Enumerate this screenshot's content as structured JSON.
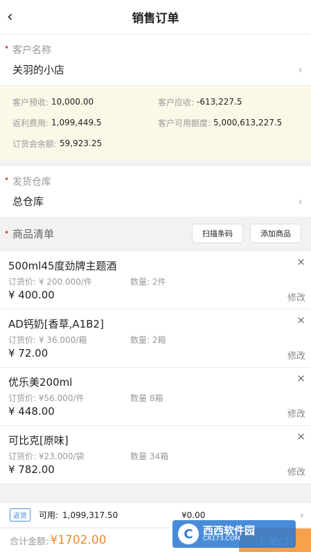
{
  "header": {
    "title": "销售订单",
    "back_icon": "chevron-left-icon"
  },
  "customer": {
    "label": "客户名称",
    "value": "关羽的小店",
    "required_mark": "•"
  },
  "credit": {
    "prepaid_label": "客户预收:",
    "prepaid_value": "10,000.00",
    "receivable_label": "客户应收:",
    "receivable_value": "-613,227.5",
    "rebate_label": "返利费用:",
    "rebate_value": "1,099,449.5",
    "available_label": "客户可用额度:",
    "available_value": "5,000,613,227.5",
    "balance_label": "订货会余额:",
    "balance_value": "59,923.25"
  },
  "warehouse": {
    "label": "发货仓库",
    "value": "总仓库",
    "required_mark": "•"
  },
  "goods": {
    "label": "商品清单",
    "required_mark": "•",
    "scan_button": "扫描条码",
    "add_button": "添加商品",
    "items": [
      {
        "name": "500ml45度劲牌主题酒",
        "price": "订货价: ¥ 200.000/件",
        "qty": "数量: 2件",
        "total": "¥ 400.00",
        "edit": "修改",
        "close": "×"
      },
      {
        "name": "AD钙奶[香草,A1B2]",
        "price": "订货价: ¥ 36.000/箱",
        "qty": "数量: 2箱",
        "total": "¥ 72.00",
        "edit": "修改",
        "close": "×"
      },
      {
        "name": "优乐美200ml",
        "price": "订货价: ¥56.000/件",
        "qty": "数量 8箱",
        "total": "¥ 448.00",
        "edit": "修改",
        "close": "×"
      },
      {
        "name": "可比克[原味]",
        "price": "订货价: ¥23.000/袋",
        "qty": "数量 34箱",
        "total": "¥ 782.00",
        "edit": "修改",
        "close": "×"
      }
    ]
  },
  "footer": {
    "tag": "返货",
    "available_label": "可用:",
    "available_value": "1,099,317.50",
    "amount": "¥0.00",
    "sum_label": "合计金额:",
    "sum_value": "¥1702.00",
    "submit": "下单(2)"
  },
  "watermark": {
    "logo": "C",
    "main": "西西软件园",
    "sub": "CR173.COM"
  },
  "colors": {
    "accent": "#f08a2a",
    "required": "#e23a3a",
    "tag": "#4a90d9",
    "credit_bg": "#fbf8e8"
  }
}
